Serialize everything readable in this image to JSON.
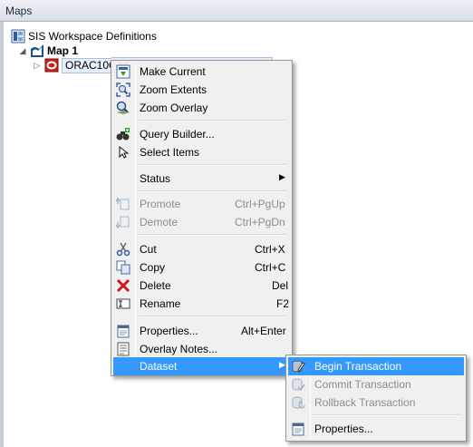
{
  "panel": {
    "title": "Maps"
  },
  "tree": {
    "root_label": "SIS Workspace Definitions",
    "map_label": "Map 1",
    "overlay_label": "ORAC10G2"
  },
  "context_menu": {
    "make_current": "Make Current",
    "zoom_extents": "Zoom Extents",
    "zoom_overlay": "Zoom Overlay",
    "query_builder": "Query Builder...",
    "select_items": "Select Items",
    "status": "Status",
    "promote": "Promote",
    "promote_shortcut": "Ctrl+PgUp",
    "demote": "Demote",
    "demote_shortcut": "Ctrl+PgDn",
    "cut": "Cut",
    "cut_shortcut": "Ctrl+X",
    "copy": "Copy",
    "copy_shortcut": "Ctrl+C",
    "delete": "Delete",
    "delete_shortcut": "Del",
    "rename": "Rename",
    "rename_shortcut": "F2",
    "properties": "Properties...",
    "properties_shortcut": "Alt+Enter",
    "overlay_notes": "Overlay Notes...",
    "dataset": "Dataset"
  },
  "submenu": {
    "begin_transaction": "Begin Transaction",
    "commit_transaction": "Commit Transaction",
    "rollback_transaction": "Rollback Transaction",
    "properties": "Properties..."
  },
  "colors": {
    "highlight": "#3399ff",
    "menu_background": "#f0f0f0",
    "disabled_text": "#8d8d8d"
  },
  "icons": {
    "workspace": "workspace-icon",
    "map": "map-icon",
    "overlay": "oracle-overlay-icon",
    "make_current": "make-current-icon",
    "zoom_extents": "zoom-extents-icon",
    "zoom_overlay": "zoom-overlay-icon",
    "query_builder": "binoculars-icon",
    "select_items": "pointer-icon",
    "promote": "promote-icon",
    "demote": "demote-icon",
    "cut": "scissors-icon",
    "copy": "copy-icon",
    "delete": "delete-x-icon",
    "rename": "rename-icon",
    "properties": "properties-icon",
    "overlay_notes": "notes-icon",
    "begin_transaction": "begin-transaction-icon",
    "commit_transaction": "commit-transaction-icon",
    "rollback_transaction": "rollback-transaction-icon"
  }
}
